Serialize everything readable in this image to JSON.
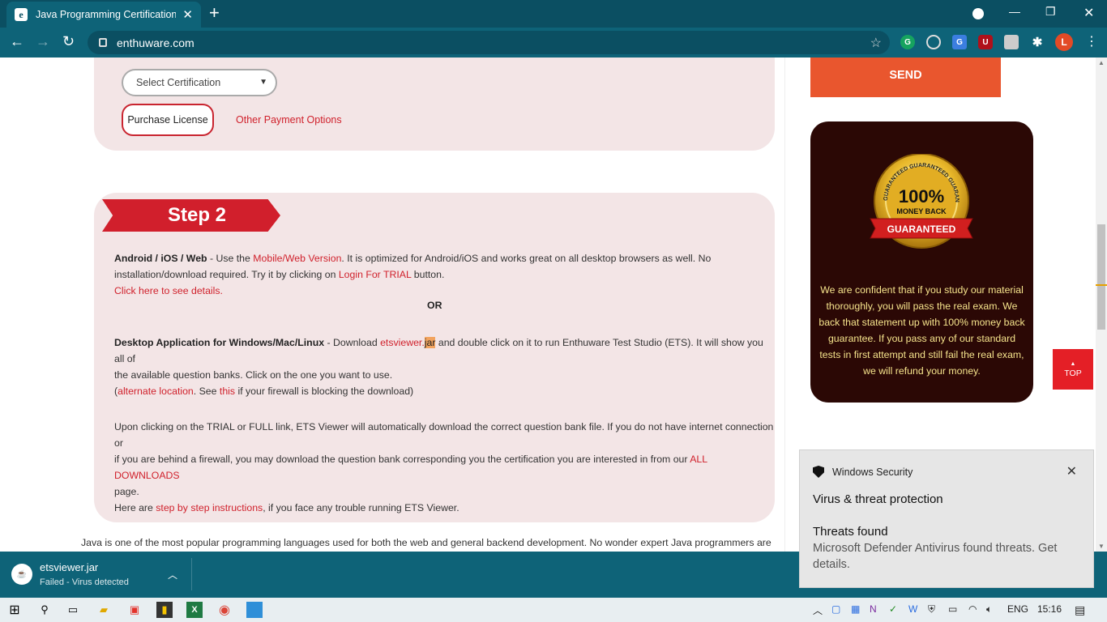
{
  "browser": {
    "tab_title": "Java Programming Certification P",
    "tab_favicon": "e",
    "url": "enthuware.com",
    "profile_initial": "L"
  },
  "card1": {
    "select_placeholder": "Select Certification",
    "purchase_label": "Purchase License",
    "other_payment": "Other Payment Options"
  },
  "step2": {
    "banner": "Step 2",
    "p1_bold": "Android / iOS / Web",
    "p1_a": " - Use the ",
    "p1_link1": "Mobile/Web Version",
    "p1_b": ". It is optimized for Android/iOS and works great on all desktop browsers as well. No",
    "p1_c": "installation/download required. Try it by clicking on ",
    "p1_link2": "Login For TRIAL",
    "p1_d": " button.",
    "p1_link3": "Click here to see details.",
    "or": "OR",
    "p2_bold": "Desktop Application for Windows/Mac/Linux",
    "p2_a": " - Download ",
    "p2_link1": "etsviewer.",
    "p2_hl": "jar",
    "p2_b": " and double click on it to run Enthuware Test Studio (ETS). It will show you all of",
    "p2_c": "the available question banks. Click on the one you want to use.",
    "p2_d": "(",
    "p2_link2": "alternate location",
    "p2_e": ". See ",
    "p2_link3": "this",
    "p2_f": " if your firewall is blocking the download)",
    "p3_a": "Upon clicking on the TRIAL or FULL link, ETS Viewer will automatically download the correct question bank file. If you do not have internet connection or",
    "p3_b": "if you are behind a firewall, you may download the question bank corresponding you the certification you are interested in from our ",
    "p3_link": "ALL DOWNLOADS",
    "p3_c": "page.",
    "p4_a": "Here are ",
    "p4_link": "step by step instructions",
    "p4_b": ", if you face any trouble running ETS Viewer."
  },
  "below_text": "Java is one of the most popular programming languages used for both the web and general backend development. No wonder expert Java programmers are",
  "sidebar": {
    "send_label": "SEND",
    "seal_line1": "100%",
    "seal_line2": "MONEY BACK",
    "seal_ribbon": "GUARANTEED",
    "seal_ring": "GUARANTEED GUARANTEED GUARANTEED",
    "guarantee_text": "We are confident that if you study our material thoroughly, you will pass the real exam. We back that statement up with 100% money back guarantee. If you pass any of our standard tests in first attempt and still fail the real exam, we will refund your money.",
    "top_label": "TOP"
  },
  "toast": {
    "app": "Windows Security",
    "title": "Virus & threat protection",
    "heading": "Threats found",
    "body": "Microsoft Defender Antivirus found threats. Get details."
  },
  "download": {
    "filename": "etsviewer.jar",
    "status": "Failed - Virus detected"
  },
  "taskbar": {
    "lang": "ENG",
    "time": "15:16"
  },
  "colors": {
    "accent_red": "#d0212c",
    "chrome_teal": "#0e6378",
    "send_orange": "#e9562e"
  }
}
